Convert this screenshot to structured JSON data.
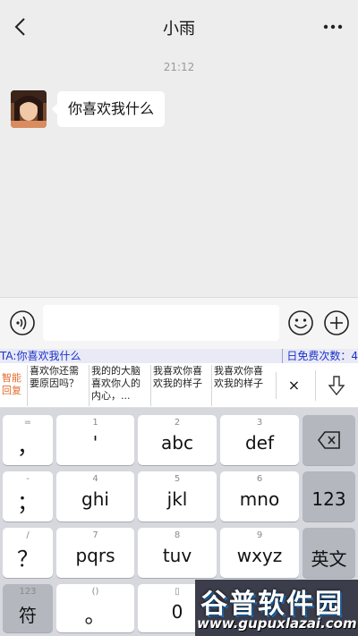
{
  "header": {
    "title": "小雨"
  },
  "chat": {
    "timestamp": "21:12",
    "messages": [
      {
        "text": "你喜欢我什么"
      }
    ]
  },
  "input": {
    "value": ""
  },
  "ime": {
    "ta_text": "TA:你喜欢我什么",
    "free_count": "日免费次数：4"
  },
  "suggestions": {
    "smart_label_1": "智能",
    "smart_label_2": "回复",
    "items": [
      {
        "line1": "喜欢你还需",
        "line2": "要原因吗？"
      },
      {
        "line1": "我的的大脑",
        "line2": "喜欢你人的",
        "line3": "内心，..."
      },
      {
        "line1": "我喜欢你喜",
        "line2": "欢我的样子"
      },
      {
        "line1": "我喜欢你喜",
        "line2": "欢我的样子"
      }
    ],
    "close_label": "×"
  },
  "keyboard": {
    "rows": [
      [
        {
          "sub": "=",
          "main": "，"
        },
        {
          "sub": "1",
          "main": "'"
        },
        {
          "sub": "2",
          "main": "abc"
        },
        {
          "sub": "3",
          "main": "def"
        }
      ],
      [
        {
          "sub": "-",
          "main": "；"
        },
        {
          "sub": "4",
          "main": "ghi"
        },
        {
          "sub": "5",
          "main": "jkl"
        },
        {
          "sub": "6",
          "main": "mno"
        }
      ],
      [
        {
          "sub": "/",
          "main": "？"
        },
        {
          "sub": "7",
          "main": "pqrs"
        },
        {
          "sub": "8",
          "main": "tuv"
        },
        {
          "sub": "9",
          "main": "wxyz"
        }
      ],
      [
        {
          "sub": "123",
          "main": "符"
        },
        {
          "sub": "()",
          "main": "。"
        },
        {
          "sub": "▯",
          "main": "0"
        }
      ]
    ],
    "right": {
      "num_label": "123",
      "lang_label": "英文"
    }
  },
  "watermark": {
    "title": "谷普软件园",
    "url": "www.gupuxlazai.com"
  },
  "colors": {
    "ime_blue": "#1a32c8",
    "smart_orange": "#e36a2e",
    "key_bg": "#ffffff",
    "key_dark": "#b4b7be"
  }
}
